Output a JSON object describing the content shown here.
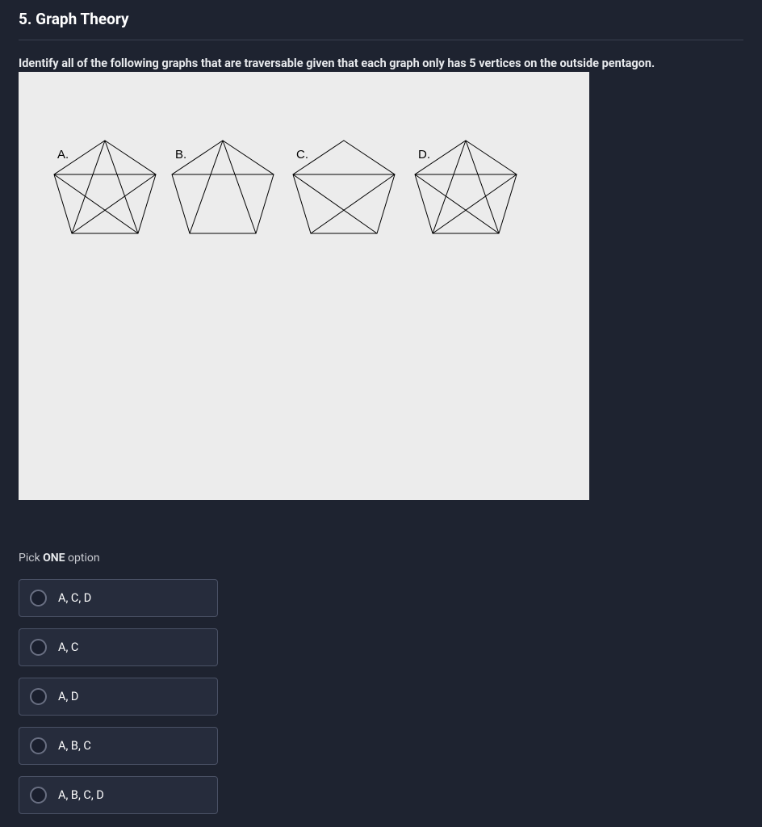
{
  "title": "5. Graph Theory",
  "question": "Identify all of the following graphs that are traversable given that each graph only has 5 vertices on the outside pentagon.",
  "graphs": {
    "A": "A.",
    "B": "B.",
    "C": "C.",
    "D": "D."
  },
  "instruction_pre": "Pick ",
  "instruction_bold": "ONE",
  "instruction_post": " option",
  "options": [
    {
      "label": "A, C, D"
    },
    {
      "label": "A, C"
    },
    {
      "label": "A, D"
    },
    {
      "label": "A, B, C"
    },
    {
      "label": "A, B, C, D"
    }
  ]
}
